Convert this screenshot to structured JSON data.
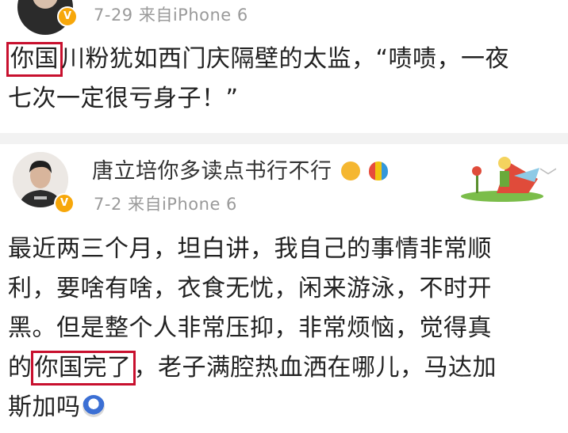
{
  "post1": {
    "meta": "7-29  来自iPhone 6",
    "line1_highlight": "你国",
    "line1_rest": "川粉犹如西门庆隔壁的太监，“啧啧，一夜",
    "line2": "七次一定很亏身子！”"
  },
  "post2": {
    "username": "唐立培你多读点书行不行",
    "meta": "7-2  来自iPhone 6",
    "lines": [
      "最近两三个月，坦白讲，我自己的事情非常顺",
      "利，要啥有啥，衣食无忧，闲来游泳，不时开",
      "黑。但是整个人非常压抑，非常烦恼，觉得真"
    ],
    "line4_pre": "的",
    "line4_highlight": "你国完了",
    "line4_rest": "，老子满腔热血洒在哪儿，马达加",
    "line5": "斯加吗"
  },
  "icons": {
    "verified": "verified-badge-icon",
    "expand": "chevron-down-icon"
  },
  "colors": {
    "highlight_border": "#c8102e",
    "meta_text": "#9a9a9a",
    "badge": "#f7a70a"
  }
}
